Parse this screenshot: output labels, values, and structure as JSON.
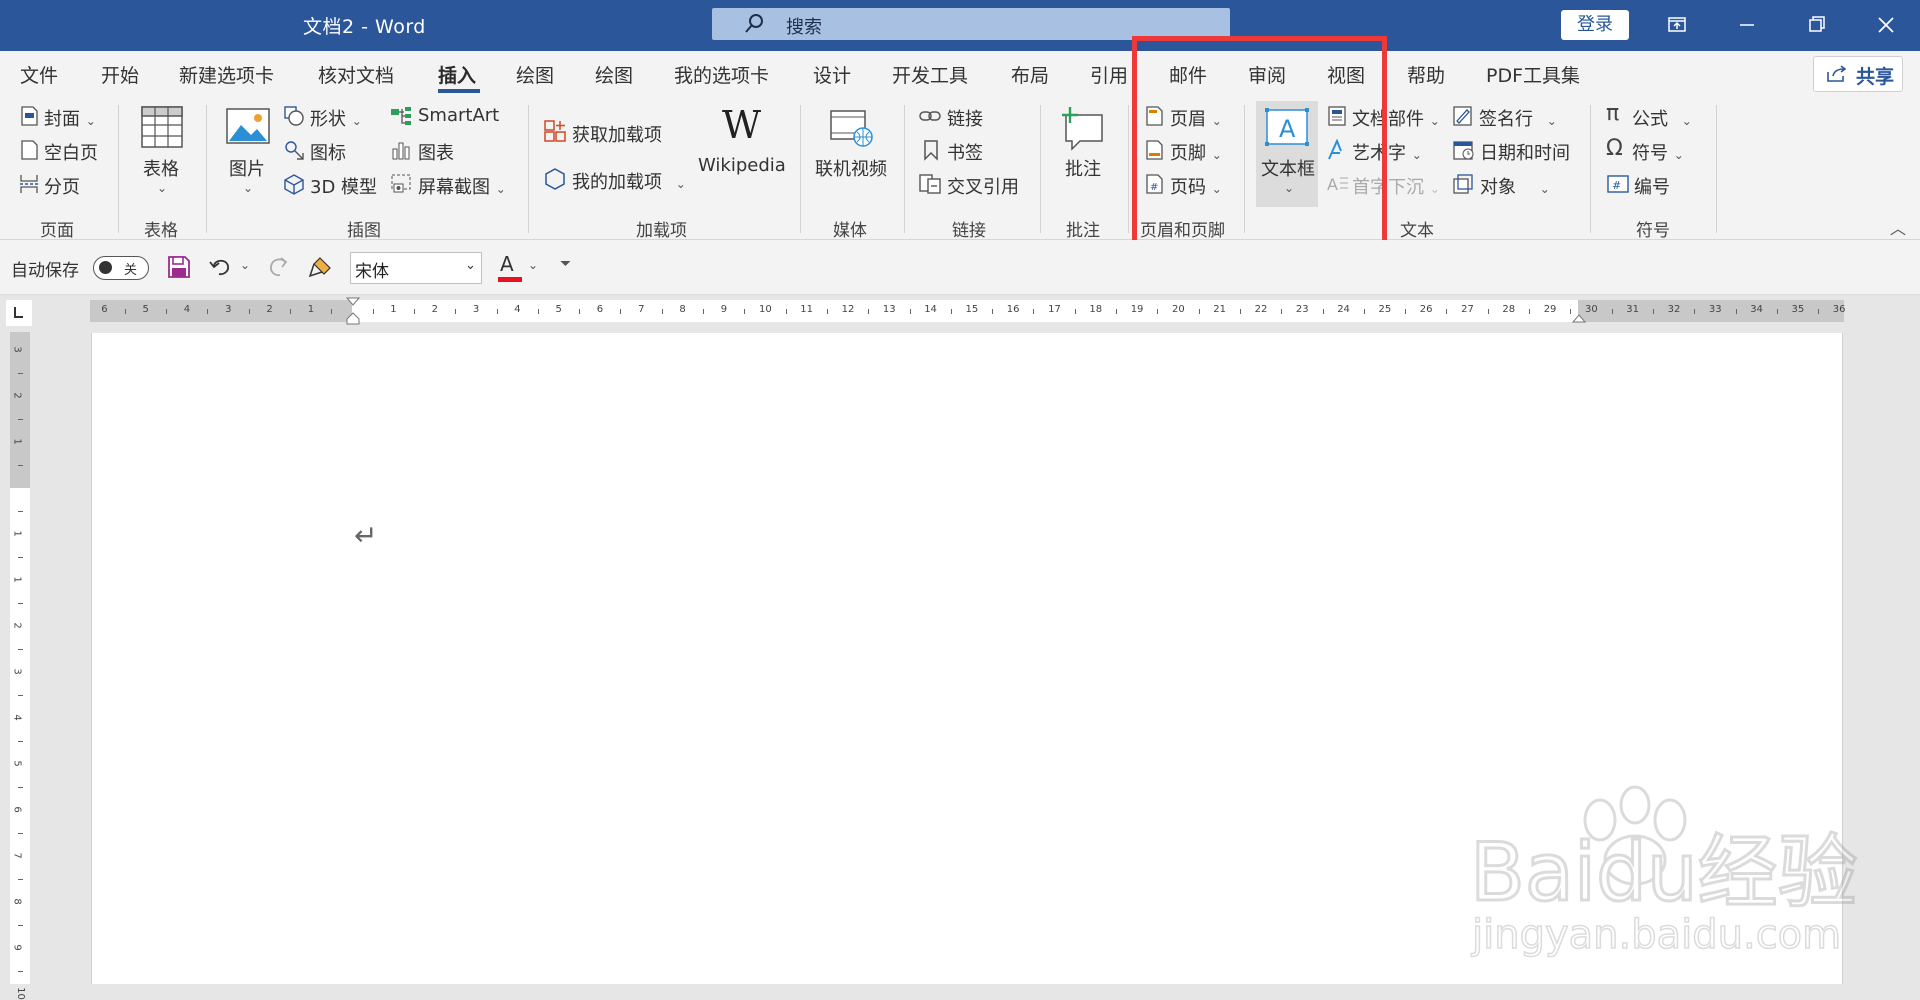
{
  "window": {
    "title": "文档2  -  Word",
    "search_placeholder": "搜索",
    "login_label": "登录"
  },
  "tabs": [
    "文件",
    "开始",
    "新建选项卡",
    "核对文档",
    "插入",
    "绘图",
    "绘图",
    "我的选项卡",
    "设计",
    "开发工具",
    "布局",
    "引用",
    "邮件",
    "审阅",
    "视图",
    "帮助",
    "PDF工具集"
  ],
  "active_tab": "插入",
  "share_label": "共享",
  "ribbon": {
    "pages": {
      "items": [
        "封面",
        "空白页",
        "分页"
      ],
      "group": "页面"
    },
    "tables": {
      "item": "表格",
      "group": "表格"
    },
    "illustrations": {
      "picture": "图片",
      "shapes": "形状",
      "icons": "图标",
      "model3d": "3D 模型",
      "smartart": "SmartArt",
      "chart": "图表",
      "screenshot": "屏幕截图",
      "group": "插图"
    },
    "addins": {
      "get": "获取加载项",
      "mine": "我的加载项",
      "wikipedia": "Wikipedia",
      "group": "加载项"
    },
    "media": {
      "online_video": "联机视频",
      "group": "媒体"
    },
    "links": {
      "link": "链接",
      "bookmark": "书签",
      "crossref": "交叉引用",
      "group": "链接"
    },
    "comments": {
      "comment": "批注",
      "group": "批注"
    },
    "header_footer": {
      "header": "页眉",
      "footer": "页脚",
      "page_number": "页码",
      "group": "页眉和页脚"
    },
    "text": {
      "textbox": "文本框",
      "quickparts": "文档部件",
      "wordart": "艺术字",
      "dropcap": "首字下沉",
      "signature": "签名行",
      "datetime": "日期和时间",
      "object": "对象",
      "group": "文本"
    },
    "symbols": {
      "equation": "公式",
      "symbol": "符号",
      "number": "编号",
      "group": "符号"
    }
  },
  "qat": {
    "autosave_label": "自动保存",
    "autosave_state": "关",
    "font_name": "宋体",
    "font_color": "#e81123"
  },
  "ruler": {
    "h_numbers": [
      "6",
      "5",
      "4",
      "3",
      "2",
      "1",
      "1",
      "2",
      "3",
      "4",
      "5",
      "6",
      "7",
      "8",
      "9",
      "10",
      "11",
      "12",
      "13",
      "14",
      "15",
      "16",
      "17",
      "18",
      "19",
      "20",
      "21",
      "22",
      "23",
      "24",
      "25",
      "26",
      "27",
      "28",
      "29",
      "30",
      "31",
      "32",
      "33",
      "34",
      "35",
      "36"
    ],
    "v_numbers": [
      "3",
      "2",
      "1",
      "1",
      "1",
      "2",
      "3",
      "4",
      "5",
      "6",
      "7",
      "8",
      "9",
      "10"
    ]
  },
  "document": {
    "paragraph_mark": "↵"
  },
  "watermark": {
    "brand": "Baidu经验",
    "url": "jingyan.baidu.com"
  },
  "colors": {
    "titlebar": "#2b579a",
    "highlight": "#ec3a3a"
  }
}
